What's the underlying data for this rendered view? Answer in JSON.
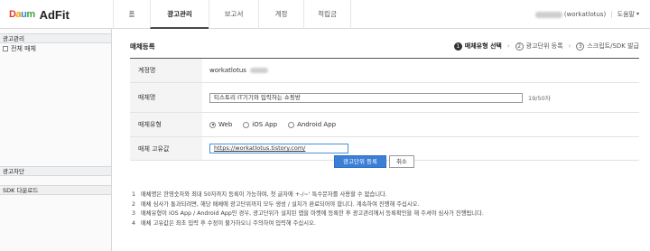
{
  "logo": {
    "brand_parts": [
      "D",
      "a",
      "u",
      "m"
    ],
    "product": "AdFit"
  },
  "nav": [
    {
      "label": "홈"
    },
    {
      "label": "광고관리",
      "active": true
    },
    {
      "label": "보고서"
    },
    {
      "label": "계정"
    },
    {
      "label": "적립금"
    }
  ],
  "user": {
    "id_suffix": "(workatlotus)",
    "help": "도움말",
    "help_arrow": "▾"
  },
  "sidebar": {
    "section_ad": "광고관리",
    "item_all_media": "전체 매체",
    "section_block": "광고차단",
    "section_sdk": "SDK 다운로드"
  },
  "page": {
    "title": "매체등록"
  },
  "steps": [
    {
      "num": "1",
      "label": "매체유형 선택",
      "active": true
    },
    {
      "num": "2",
      "label": "광고단위 등록"
    },
    {
      "num": "3",
      "label": "스크립트/SDK 발급"
    }
  ],
  "step_arrow": "›",
  "form": {
    "account_label": "계정명",
    "account_value": "workatlotus",
    "media_name_label": "매체명",
    "media_name_value": "티스토리 IT기기와 입력하는 쇼핑방",
    "media_name_count": "19/50자",
    "media_type_label": "매체유형",
    "types": [
      "Web",
      "iOS App",
      "Android App"
    ],
    "selected_type": "Web",
    "media_id_label": "매체 고유값",
    "media_id_value": "https://workatlotus.tistory.com/"
  },
  "buttons": {
    "register_unit": "광고단위 등록",
    "cancel": "취소"
  },
  "notes": [
    {
      "num": "1",
      "text": "매체명은 한영숫자와 최대 50자까지 등록이 가능하며, 첫 글자에 +-/~' 특수문자를 사용할 수 없습니다."
    },
    {
      "num": "2",
      "text": "매체 심사가 통과되려면, 해당 매체에 광고단위까지 모두 생성 / 설치가 완료되어야 합니다. 계속하여 진행해 주십시오."
    },
    {
      "num": "3",
      "text": "매체유형이 iOS App / Android App인 경우, 광고단위가 설치된 앱을 마켓에 등록한 후 광고관리에서 등록확인을 해 주셔야 심사가 진행됩니다."
    },
    {
      "num": "4",
      "text": "매체 고유값은 최초 입력 후 수정이 불가하오니 주의하여 입력해 주십시오."
    }
  ],
  "colors": {
    "primary_button": "#3b7fd6",
    "logo_d": "#e23b2f",
    "logo_a": "#f4a100",
    "logo_u": "#2f88d6",
    "logo_m": "#3ea540"
  }
}
